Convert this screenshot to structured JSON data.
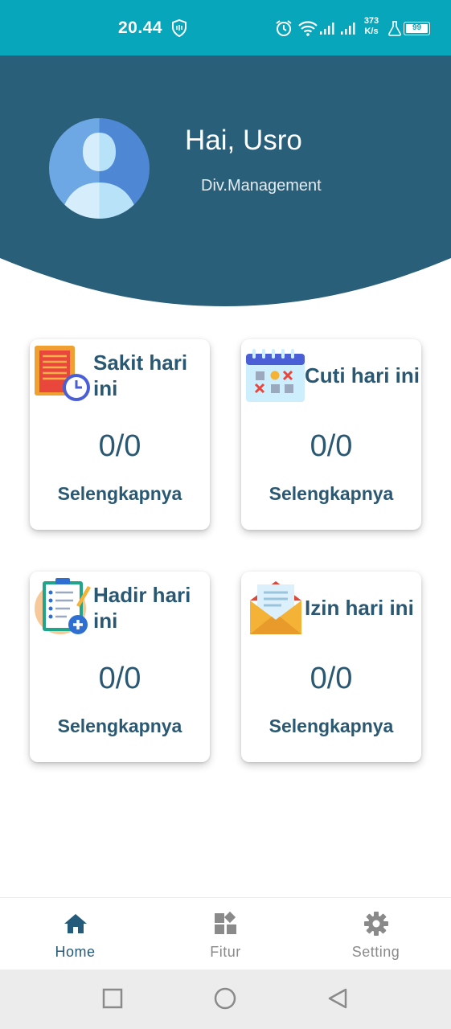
{
  "status_bar": {
    "time": "20.44",
    "network_speed_value": "373",
    "network_speed_unit": "K/s",
    "battery": "99",
    "icons": [
      "shield-icon",
      "alarm-icon",
      "wifi-icon",
      "signal-icon",
      "signal-icon",
      "flask-icon",
      "battery-icon"
    ]
  },
  "header": {
    "greeting": "Hai, Usro",
    "division": "Div.Management",
    "background_color": "#2a5f7a"
  },
  "cards": [
    {
      "title_line1": "Sakit hari",
      "title_line2": "ini",
      "value": "0/0",
      "link": "Selengkapnya",
      "icon": "sick-report-icon"
    },
    {
      "title_line1": "Cuti hari ini",
      "title_line2": "",
      "value": "0/0",
      "link": "Selengkapnya",
      "icon": "calendar-leave-icon"
    },
    {
      "title_line1": "Hadir hari",
      "title_line2": "ini",
      "value": "0/0",
      "link": "Selengkapnya",
      "icon": "checklist-attendance-icon"
    },
    {
      "title_line1": "Izin hari ini",
      "title_line2": "",
      "value": "0/0",
      "link": "Selengkapnya",
      "icon": "envelope-permission-icon"
    }
  ],
  "bottom_nav": {
    "items": [
      {
        "label": "Home",
        "icon": "home-icon",
        "active": true
      },
      {
        "label": "Fitur",
        "icon": "grid-icon",
        "active": false
      },
      {
        "label": "Setting",
        "icon": "gear-icon",
        "active": false
      }
    ],
    "active_color": "#245a7a",
    "inactive_color": "#8a8a8a"
  },
  "system_nav": {
    "icons": [
      "recents-square-icon",
      "home-circle-icon",
      "back-triangle-icon"
    ]
  },
  "colors": {
    "status_bar": "#08a6bb",
    "text_primary": "#2a5872"
  }
}
